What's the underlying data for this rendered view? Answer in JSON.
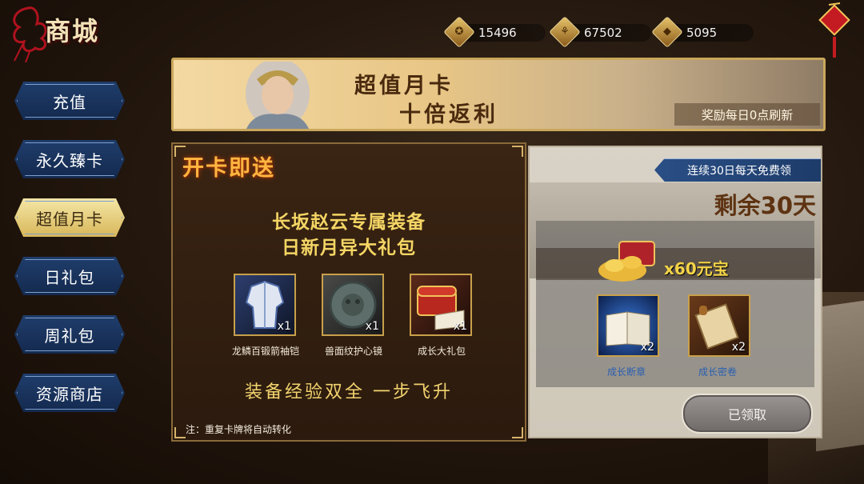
{
  "header": {
    "title": "商城",
    "currencies": [
      {
        "icon": "coin-icon",
        "value": "15496"
      },
      {
        "icon": "grain-icon",
        "value": "67502"
      },
      {
        "icon": "ingot-icon",
        "value": "5095"
      }
    ]
  },
  "sidebar": {
    "items": [
      {
        "label": "充值"
      },
      {
        "label": "永久臻卡"
      },
      {
        "label": "超值月卡",
        "active": true
      },
      {
        "label": "日礼包"
      },
      {
        "label": "周礼包"
      },
      {
        "label": "资源商店"
      }
    ]
  },
  "banner": {
    "line1": "超值月卡",
    "line2": "十倍返利",
    "note": "奖励每日0点刷新"
  },
  "left_panel": {
    "header": "开卡即送",
    "subtitle1": "长坂赵云专属装备",
    "subtitle2": "日新月异大礼包",
    "items": [
      {
        "name": "龙鳞百锻箭袖铠",
        "qty": "x1",
        "icon": "armor-icon"
      },
      {
        "name": "兽面纹护心镜",
        "qty": "x1",
        "icon": "mirror-icon"
      },
      {
        "name": "成长大礼包",
        "qty": "x1",
        "icon": "chest-book-icon"
      }
    ],
    "slogan": "装备经验双全  一步飞升",
    "footnote": "注：重复卡牌将自动转化"
  },
  "right_panel": {
    "ribbon": "连续30日每天免费领",
    "remaining": "剩余30天",
    "yuanbao": "x60元宝",
    "items": [
      {
        "name": "成长断章",
        "qty": "x2",
        "icon": "book-icon"
      },
      {
        "name": "成长密卷",
        "qty": "x2",
        "icon": "scroll-icon"
      }
    ],
    "claim_button": "已领取"
  },
  "colors": {
    "gold_text": "#f4d564",
    "sidebar_blue": "#1f3d6b",
    "sidebar_active": "#e8cf7a",
    "claimed_grey": "#8a8582"
  }
}
